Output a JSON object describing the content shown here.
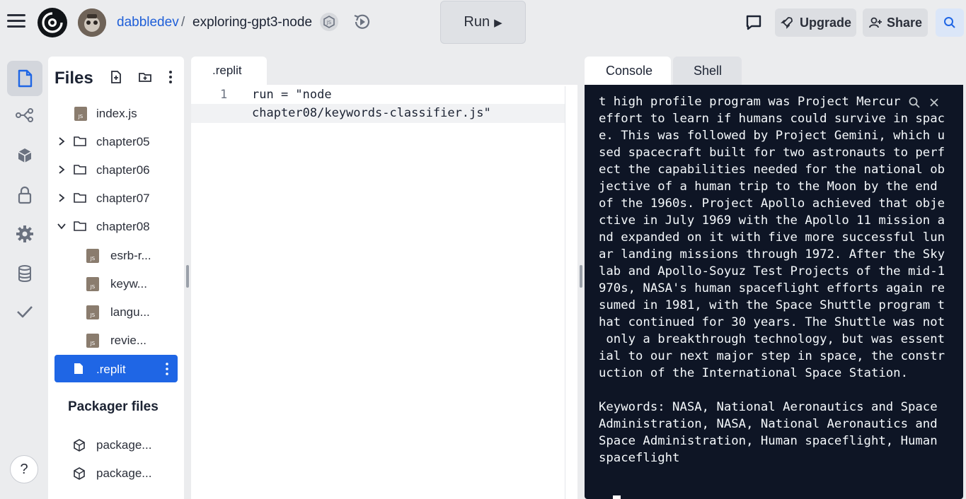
{
  "topbar": {
    "user": "dabbledev",
    "separator": "/",
    "repl_name": "exploring-gpt3-node",
    "run_label": "Run",
    "run_icon": "▶",
    "upgrade_label": "Upgrade",
    "share_label": "Share"
  },
  "rail": {
    "items": [
      "files-icon",
      "git-icon",
      "packages-icon",
      "secrets-icon",
      "settings-icon",
      "database-icon",
      "unit-tests-icon"
    ],
    "help_label": "?"
  },
  "files": {
    "title": "Files",
    "tree": [
      {
        "type": "file",
        "label": "index.js",
        "indent": 0
      },
      {
        "type": "folder",
        "label": "chapter05",
        "open": false
      },
      {
        "type": "folder",
        "label": "chapter06",
        "open": false
      },
      {
        "type": "folder",
        "label": "chapter07",
        "open": false
      },
      {
        "type": "folder",
        "label": "chapter08",
        "open": true
      },
      {
        "type": "file",
        "label": "esrb-r...",
        "indent": 1
      },
      {
        "type": "file",
        "label": "keyw...",
        "indent": 1
      },
      {
        "type": "file",
        "label": "langu...",
        "indent": 1
      },
      {
        "type": "file",
        "label": "revie...",
        "indent": 1
      },
      {
        "type": "config",
        "label": ".replit",
        "selected": true
      }
    ],
    "packager_title": "Packager files",
    "packager_items": [
      "package...",
      "package..."
    ]
  },
  "editor": {
    "tab_label": ".replit",
    "line_number": "1",
    "code_line_1": "run = \"node",
    "code_line_2": "chapter08/keywords-classifier.js\""
  },
  "console": {
    "tab_console": "Console",
    "tab_shell": "Shell",
    "output_lines": [
      "t high profile program was Project Mercur",
      "effort to learn if humans could survive in spac",
      "e. This was followed by Project Gemini, which u",
      "sed spacecraft built for two astronauts to perf",
      "ect the capabilities needed for the national ob",
      "jective of a human trip to the Moon by the end",
      "of the 1960s. Project Apollo achieved that obje",
      "ctive in July 1969 with the Apollo 11 mission a",
      "nd expanded on it with five more successful lun",
      "ar landing missions through 1972. After the Sky",
      "lab and Apollo-Soyuz Test Projects of the mid-1",
      "970s, NASA's human spaceflight efforts again re",
      "sumed in 1981, with the Space Shuttle program t",
      "hat continued for 30 years. The Shuttle was not",
      " only a breakthrough technology, but was essent",
      "ial to our next major step in space, the constr",
      "uction of the International Space Station.",
      "",
      "Keywords: NASA, National Aeronautics and Space",
      "Administration, NASA, National Aeronautics and",
      "Space Administration, Human spaceflight, Human",
      "spaceflight"
    ],
    "prompt": "›"
  },
  "colors": {
    "accent": "#1f66e5",
    "link": "#1f5fd8",
    "console_bg": "#0e1525",
    "page_bg": "#ebecee"
  }
}
